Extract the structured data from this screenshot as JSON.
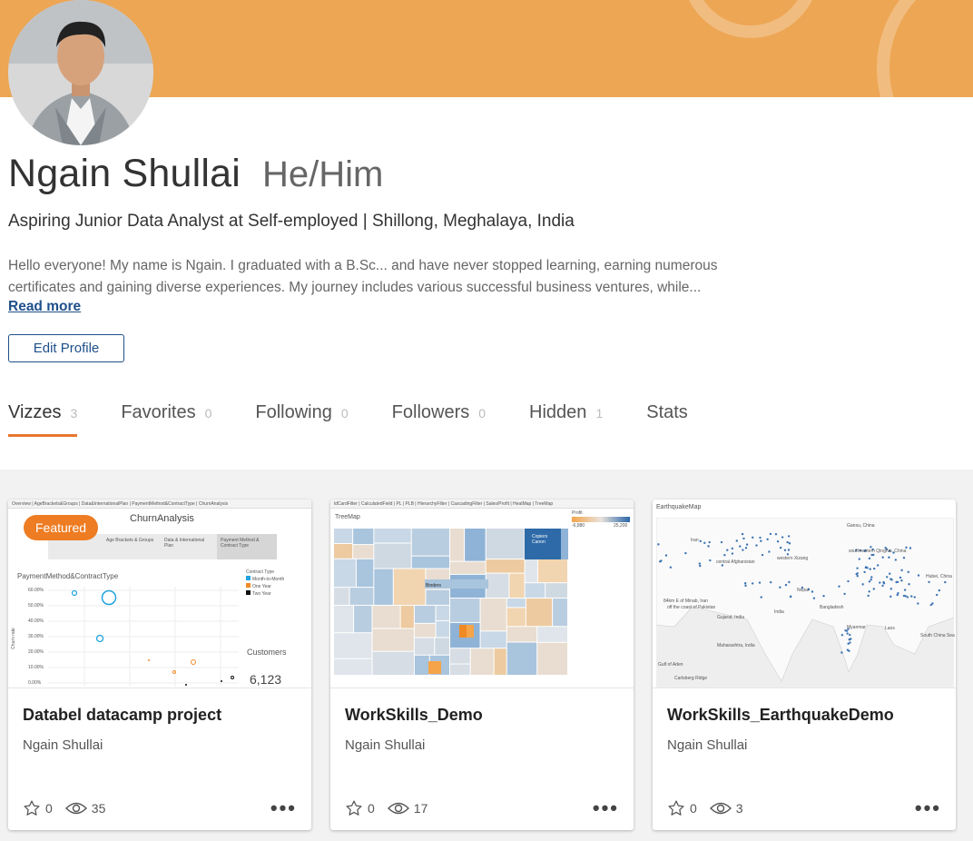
{
  "profile": {
    "name": "Ngain Shullai",
    "pronouns": "He/Him",
    "headline": "Aspiring Junior Data Analyst at Self-employed | Shillong, Meghalaya, India",
    "bio": "Hello everyone! My name is Ngain. I graduated with a B.Sc... and have never stopped learning, earning numerous certificates and gaining diverse experiences. My journey includes various successful business ventures, while...",
    "read_more": "Read more",
    "edit_profile": "Edit Profile"
  },
  "colors": {
    "banner": "#eda654",
    "accent": "#e8762d",
    "link": "#1f4f8a",
    "featured": "#ee7c22"
  },
  "tabs": [
    {
      "label": "Vizzes",
      "count": "3"
    },
    {
      "label": "Favorites",
      "count": "0"
    },
    {
      "label": "Following",
      "count": "0"
    },
    {
      "label": "Followers",
      "count": "0"
    },
    {
      "label": "Hidden",
      "count": "1"
    },
    {
      "label": "Stats",
      "count": ""
    }
  ],
  "cards": [
    {
      "title": "Databel datacamp project",
      "author": "Ngain Shullai",
      "favorites": "0",
      "views": "35",
      "featured": "Featured",
      "thumb": {
        "tabs": "Overview | AgeBrackets&Groups | Data&InternationalPlan | PaymentMethod&ContractType | ChurnAnalysis",
        "title": "ChurnAnalysis",
        "nav": [
          "Age Brackets & Groups",
          "Data & International Plan",
          "Payment Method & Contract Type"
        ],
        "subtitle": "PaymentMethod&ContractType",
        "legend_title": "Contract Type",
        "legend": [
          "Month-to-Month",
          "One Year",
          "Two Year"
        ],
        "yticks": [
          "60.00%",
          "50.00%",
          "40.00%",
          "30.00%",
          "20.00%",
          "10.00%",
          "0.00%"
        ],
        "ylabel": "Churn rate",
        "customers_label": "Customers",
        "customers_value": "6,123"
      }
    },
    {
      "title": "WorkSkills_Demo",
      "author": "Ngain Shullai",
      "favorites": "0",
      "views": "17",
      "thumb": {
        "tabs": "ldCardFilter | CalculatedField | PL | PLB | HierarchyFilter | CascadingFilter | Sales/Profit | HeatMap | TreeMap",
        "title": "TreeMap",
        "legend_title": "Profit",
        "legend_min": "-6,880",
        "legend_max": "25,200",
        "labels": [
          "Binders",
          "Copiers Canon"
        ]
      }
    },
    {
      "title": "WorkSkills_EarthquakeDemo",
      "author": "Ngain Shullai",
      "favorites": "0",
      "views": "3",
      "thumb": {
        "title": "EarthquakeMap",
        "places": [
          "Gansu, China",
          "Iran",
          "central Afghanistan",
          "western Xizang",
          "southeastern Qinghai, China",
          "Hubei, China",
          "84km E of Minab, Iran",
          "off the coast of Pakistan",
          "Nepal",
          "Gujarat, India",
          "India",
          "Bangladesh",
          "Myanmar",
          "Laos",
          "Maharashtra, India",
          "South China Sea",
          "Gulf of Aden",
          "Carlsberg Ridge"
        ]
      }
    }
  ]
}
